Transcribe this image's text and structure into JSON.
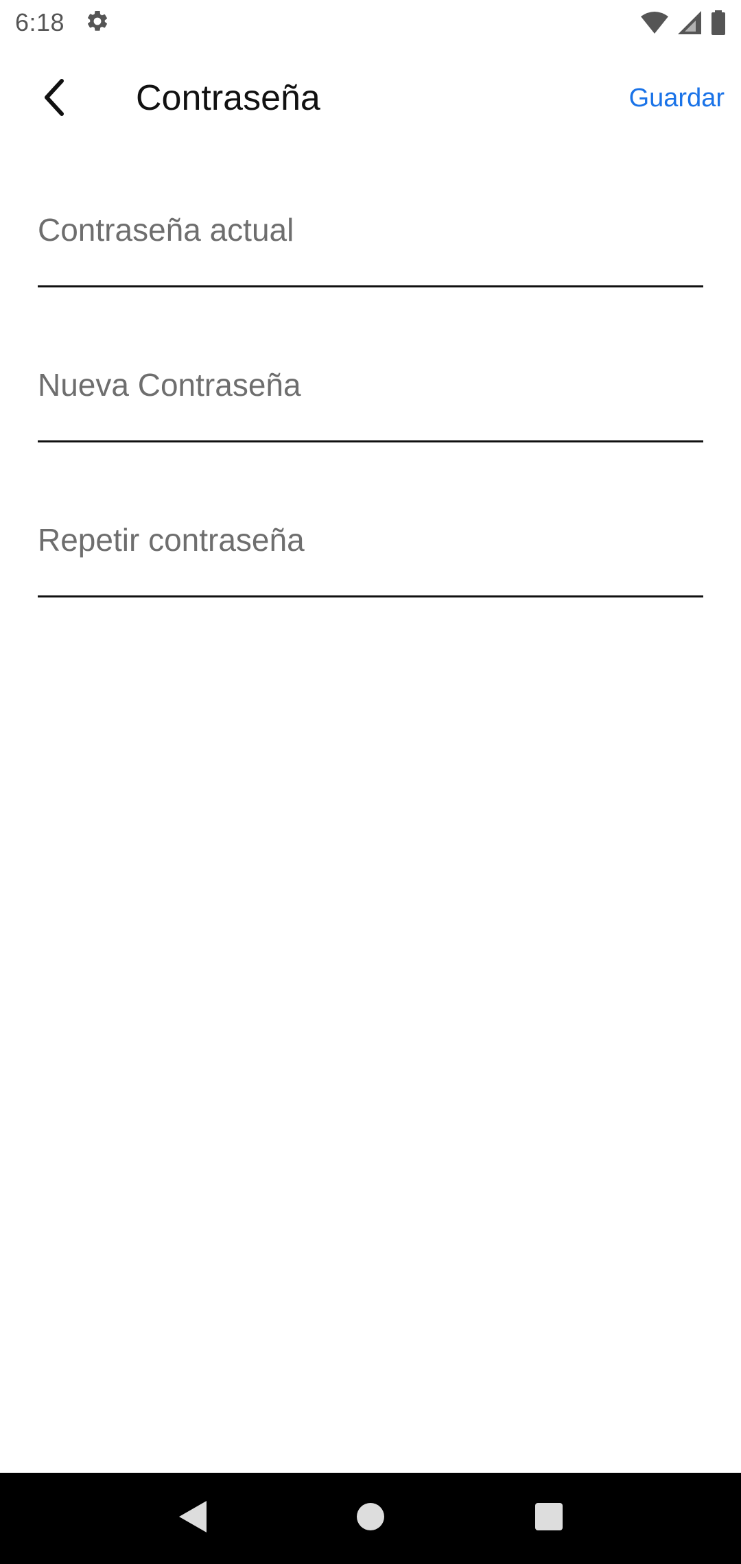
{
  "status_bar": {
    "time": "6:18",
    "icons": [
      "settings-gear-icon",
      "wifi-icon",
      "cell-signal-icon",
      "battery-icon"
    ]
  },
  "app_bar": {
    "back_icon": "chevron-left-icon",
    "title": "Contraseña",
    "save_label": "Guardar"
  },
  "form": {
    "fields": [
      {
        "placeholder": "Contraseña actual",
        "value": ""
      },
      {
        "placeholder": "Nueva Contraseña",
        "value": ""
      },
      {
        "placeholder": "Repetir contraseña",
        "value": ""
      }
    ]
  },
  "nav_bar": {
    "icons": [
      "back-triangle-icon",
      "home-circle-icon",
      "recents-square-icon"
    ]
  },
  "colors": {
    "accent": "#1a73e8",
    "title_text": "#111111",
    "placeholder_text": "#6e6e6e",
    "underline": "#111111",
    "nav_background": "#000000",
    "nav_icons": "#dddddd"
  }
}
